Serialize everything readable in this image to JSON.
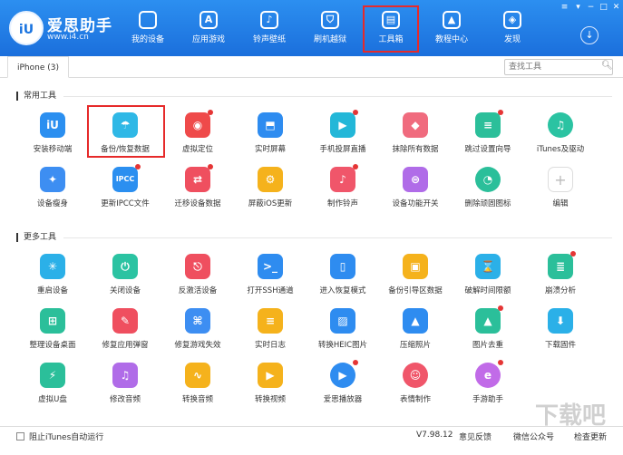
{
  "app": {
    "brand": "爱思助手",
    "url": "www.i4.cn",
    "logo_text": "iU"
  },
  "nav": [
    {
      "label": "我的设备",
      "icon": "apple-icon"
    },
    {
      "label": "应用游戏",
      "icon": "app-store-icon"
    },
    {
      "label": "铃声壁纸",
      "icon": "music-icon"
    },
    {
      "label": "刷机越狱",
      "icon": "shield-icon"
    },
    {
      "label": "工具箱",
      "icon": "toolbox-icon",
      "active": true
    },
    {
      "label": "教程中心",
      "icon": "graduation-cap-icon"
    },
    {
      "label": "发现",
      "icon": "compass-icon"
    }
  ],
  "tab": {
    "label": "iPhone (3)"
  },
  "search": {
    "placeholder": "查找工具"
  },
  "sections": {
    "common": "常用工具",
    "more": "更多工具"
  },
  "common_tools": [
    {
      "label": "安装移动端",
      "color": "#2b8ff0",
      "glyph": "iU"
    },
    {
      "label": "备份/恢复数据",
      "color": "#2fb8e6",
      "glyph": "☂"
    },
    {
      "label": "虚拟定位",
      "color": "#ef4a4a",
      "glyph": "◉",
      "dot": true
    },
    {
      "label": "实时屏幕",
      "color": "#2e8cf0",
      "glyph": "⬒"
    },
    {
      "label": "手机投屏直播",
      "color": "#23b7d8",
      "glyph": "▶",
      "dot": true
    },
    {
      "label": "抹除所有数据",
      "color": "#f06b7e",
      "glyph": "◆"
    },
    {
      "label": "跳过设置向导",
      "color": "#2bbf9a",
      "glyph": "≡",
      "dot": true
    },
    {
      "label": "iTunes及驱动",
      "color": "#2bc3a2",
      "glyph": "♫",
      "round": true
    },
    {
      "label": "设备瘦身",
      "color": "#3d8ef2",
      "glyph": "✦"
    },
    {
      "label": "更新IPCC文件",
      "color": "#2b8ff0",
      "glyph": "IPCC",
      "dot": true
    },
    {
      "label": "迁移设备数据",
      "color": "#ef4f5f",
      "glyph": "⇄",
      "dot": true
    },
    {
      "label": "屏蔽iOS更新",
      "color": "#f5b21c",
      "glyph": "⚙"
    },
    {
      "label": "制作铃声",
      "color": "#f0566a",
      "glyph": "♪",
      "dot": true
    },
    {
      "label": "设备功能开关",
      "color": "#b06ce8",
      "glyph": "⊜"
    },
    {
      "label": "删除顽固图标",
      "color": "#2bbf9a",
      "glyph": "◔",
      "round": true
    },
    {
      "label": "编辑",
      "color": "#ffffff",
      "glyph": "+",
      "plain": true
    }
  ],
  "more_tools": [
    {
      "label": "重启设备",
      "color": "#2bb0e8",
      "glyph": "✳"
    },
    {
      "label": "关闭设备",
      "color": "#2bc3a2",
      "glyph": "⏻"
    },
    {
      "label": "反激活设备",
      "color": "#ef4f5f",
      "glyph": "⎋"
    },
    {
      "label": "打开SSH通道",
      "color": "#2e8cf0",
      "glyph": ">_"
    },
    {
      "label": "进入恢复模式",
      "color": "#2e8cf0",
      "glyph": "▯"
    },
    {
      "label": "备份引导区数据",
      "color": "#f5b21c",
      "glyph": "▣"
    },
    {
      "label": "破解时间限额",
      "color": "#2bb0e8",
      "glyph": "⌛"
    },
    {
      "label": "崩溃分析",
      "color": "#2bbf9a",
      "glyph": "≣",
      "dot": true
    },
    {
      "label": "整理设备桌面",
      "color": "#2bbf9a",
      "glyph": "⊞"
    },
    {
      "label": "修复应用弹窗",
      "color": "#ef4f5f",
      "glyph": "✎"
    },
    {
      "label": "修复游戏失效",
      "color": "#3d8ef2",
      "glyph": "⌘"
    },
    {
      "label": "实时日志",
      "color": "#f5b21c",
      "glyph": "≡"
    },
    {
      "label": "转换HEIC图片",
      "color": "#2e8cf0",
      "glyph": "▨"
    },
    {
      "label": "压缩照片",
      "color": "#2e8cf0",
      "glyph": "▲"
    },
    {
      "label": "图片去重",
      "color": "#2bbf9a",
      "glyph": "▲",
      "dot": true
    },
    {
      "label": "下载固件",
      "color": "#2bb0e8",
      "glyph": "⬇"
    },
    {
      "label": "虚拟U盘",
      "color": "#2bbf9a",
      "glyph": "⚡"
    },
    {
      "label": "修改音频",
      "color": "#b06ce8",
      "glyph": "♫"
    },
    {
      "label": "转换音频",
      "color": "#f5b21c",
      "glyph": "∿"
    },
    {
      "label": "转换视频",
      "color": "#f5b21c",
      "glyph": "▶"
    },
    {
      "label": "爱思播放器",
      "color": "#2e8cf0",
      "glyph": "▶",
      "round": true,
      "dot": true
    },
    {
      "label": "表情制作",
      "color": "#f0566a",
      "glyph": "☺",
      "round": true
    },
    {
      "label": "手游助手",
      "color": "#c16be8",
      "glyph": "e",
      "round": true,
      "dot": true
    }
  ],
  "status": {
    "checkbox_label": "阻止iTunes自动运行",
    "version": "V7.98.12",
    "feedback": "意见反馈",
    "wechat": "微信公众号",
    "update": "检查更新"
  },
  "watermark": "下载吧"
}
